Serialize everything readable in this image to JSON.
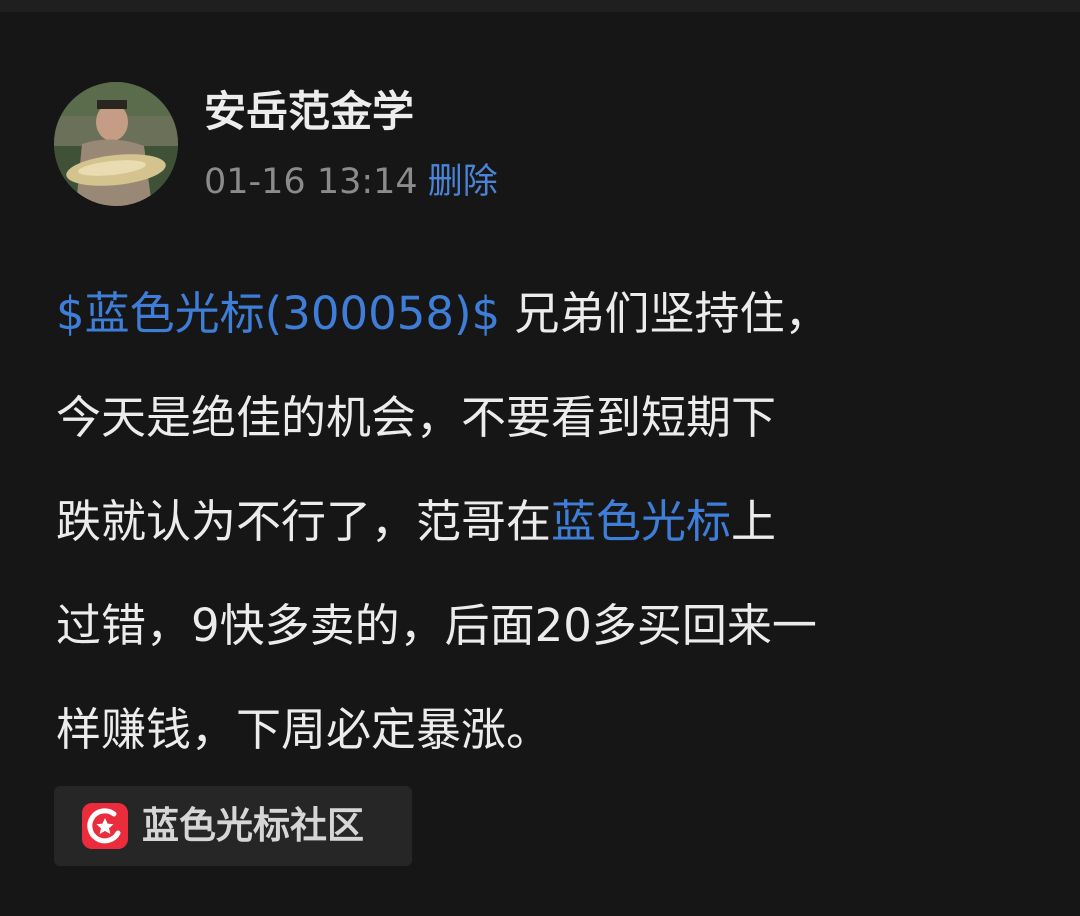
{
  "author": {
    "name": "安岳范金学",
    "timestamp": "01-16 13:14",
    "delete_label": "删除"
  },
  "post": {
    "lines": [
      [
        {
          "text": "$蓝色光标(300058)$",
          "link": true
        },
        {
          "text": " 兄弟们坚持住，",
          "link": false
        }
      ],
      [
        {
          "text": "今天是绝佳的机会，不要看到短期下",
          "link": false
        }
      ],
      [
        {
          "text": "跌就认为不行了，范哥在",
          "link": false
        },
        {
          "text": "蓝色光标",
          "link": true
        },
        {
          "text": "上",
          "link": false
        }
      ],
      [
        {
          "text": "过错，9快多卖的，后面20多买回来一",
          "link": false
        }
      ],
      [
        {
          "text": "样赚钱，下周必定暴涨。",
          "link": false
        }
      ]
    ]
  },
  "community": {
    "label": "蓝色光标社区",
    "icon": "community-logo-icon"
  },
  "colors": {
    "background": "#161616",
    "link": "#3f7ed8",
    "timestamp": "#8b8b8b",
    "chip_background": "#262626",
    "community_icon": "#ea2c3c"
  }
}
